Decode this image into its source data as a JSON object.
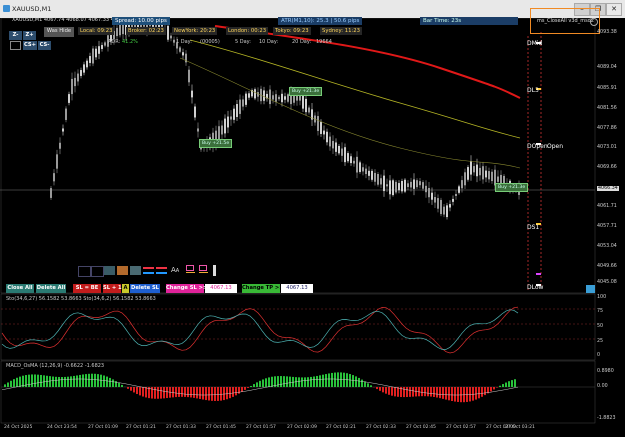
{
  "window": {
    "title": "XAUUSD,M1",
    "min": "–",
    "max": "❐",
    "close": "✕"
  },
  "header": {
    "symbol_line": "XAUUSD,M1   4067.74 4068.07 4067.33 4068.55",
    "spread": "Spread: 10.00 pips",
    "atr": "ATR(M1,10): 25.3  |  50.6 pips",
    "bar_time": "Bar Time: 23s",
    "ea_label": "ms_CloseAll v3d_msd2"
  },
  "sessions": {
    "local": "Local: 09:23",
    "broker": "Broker: 02:23",
    "newyork": "NewYork: 20:23",
    "london": "London: 00:23",
    "tokyo": "Tokyo: 09:23",
    "sydney": "Sydney: 11:23"
  },
  "controls": {
    "z_minus": "Z-",
    "z_plus": "Z+",
    "cs_plus": "CS+",
    "cs_minus": "CS-",
    "was_hide": "Was Hide"
  },
  "adr": {
    "label": "ADR:",
    "adr_value": "41.2%",
    "h_label": "1 Day:",
    "h_value": "(00005)",
    "d5_label": "5 Day:",
    "d10_label": "10 Day:",
    "d20_label": "20 Day:",
    "d20_value": "19664"
  },
  "levels": {
    "dmid": "DMid",
    "dl3": "DL3",
    "dopen": "DOpen",
    "dopen2": "Open",
    "ds1": "DS1",
    "dlow": "DLow"
  },
  "trade_tags": [
    "Buy +21.3e",
    "Buy +21.5e",
    "Buy +21.3e"
  ],
  "price_axis": [
    "4093.38",
    "4089.04",
    "4085.91",
    "4081.56",
    "4077.86",
    "4073.01",
    "4069.66",
    "4066.34",
    "4061.71",
    "4057.71",
    "4053.04",
    "4049.66",
    "4045.08"
  ],
  "current_price": "4066.34",
  "buttons": {
    "close_all": "Close All",
    "delete_all": "Delete All",
    "sl_be": "SL = BE",
    "sl_plus1": "SL + 1",
    "a": "A",
    "delete_sl": "Delete SL",
    "change_sl": "Change SL >>",
    "sl_value": "4067.13",
    "change_tp": "Change TP >>",
    "tp_value": "4067.13"
  },
  "stoch": {
    "label": "Sto(34,6,27) 56.1582 53.8663   Sto(34,6,2) 56.1582 53.8663",
    "axis": [
      "100",
      "75",
      "50",
      "25",
      "0"
    ]
  },
  "macd": {
    "label": "MACD_OsMA (12,26,9)  -0.6622  -1.6823",
    "axis": [
      "0.8980",
      "0.00",
      "-1.8823"
    ]
  },
  "time_axis": [
    "24 Oct 2025",
    "24 Oct 23:54",
    "27 Oct 01:09",
    "27 Oct 01:21",
    "27 Oct 01:33",
    "27 Oct 01:45",
    "27 Oct 01:57",
    "27 Oct 02:09",
    "27 Oct 02:21",
    "27 Oct 02:33",
    "27 Oct 02:45",
    "27 Oct 02:57",
    "27 Oct 03:09",
    "27 Oct 03:21"
  ],
  "colors": {
    "bull": "#d0d0d0",
    "bear": "#9a9a9a",
    "ma_red": "#e01818",
    "ma_yellow": "#b6b625",
    "stoch_main": "#e03030",
    "stoch_sig": "#4db3b3",
    "macd_pos": "#29c23b",
    "macd_neg": "#e02020"
  }
}
